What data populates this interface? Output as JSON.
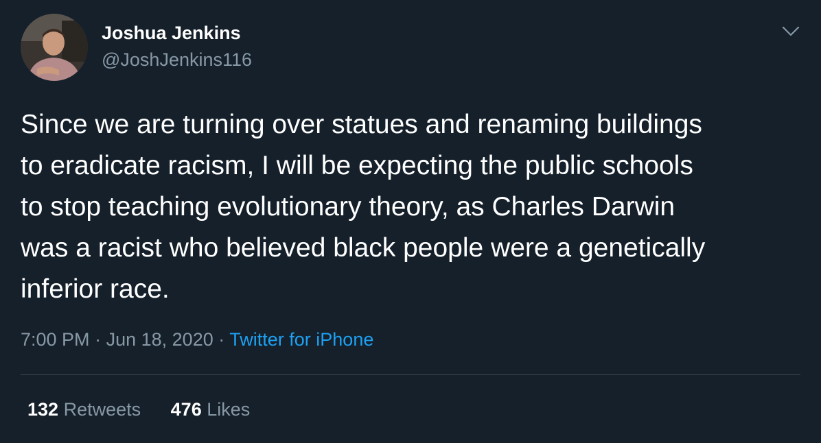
{
  "author": {
    "display_name": "Joshua Jenkins",
    "handle": "@JoshJenkins116",
    "avatar_icon": "person-photo-icon"
  },
  "menu_icon": "chevron-down-icon",
  "tweet": {
    "text_lines": [
      "Since we are turning over statues and renaming buildings",
      "to eradicate racism, I will be expecting the public schools",
      "to stop teaching evolutionary theory, as Charles Darwin",
      "was a racist who believed black people were a genetically",
      "inferior race."
    ]
  },
  "meta": {
    "time": "7:00 PM",
    "separator": "·",
    "date": "Jun 18, 2020",
    "source": "Twitter for iPhone"
  },
  "stats": {
    "retweets_count": "132",
    "retweets_label": "Retweets",
    "likes_count": "476",
    "likes_label": "Likes"
  },
  "colors": {
    "background": "#15202b",
    "primary_text": "#ffffff",
    "secondary_text": "#8899a6",
    "link": "#1da1f2",
    "divider": "#38444d"
  }
}
